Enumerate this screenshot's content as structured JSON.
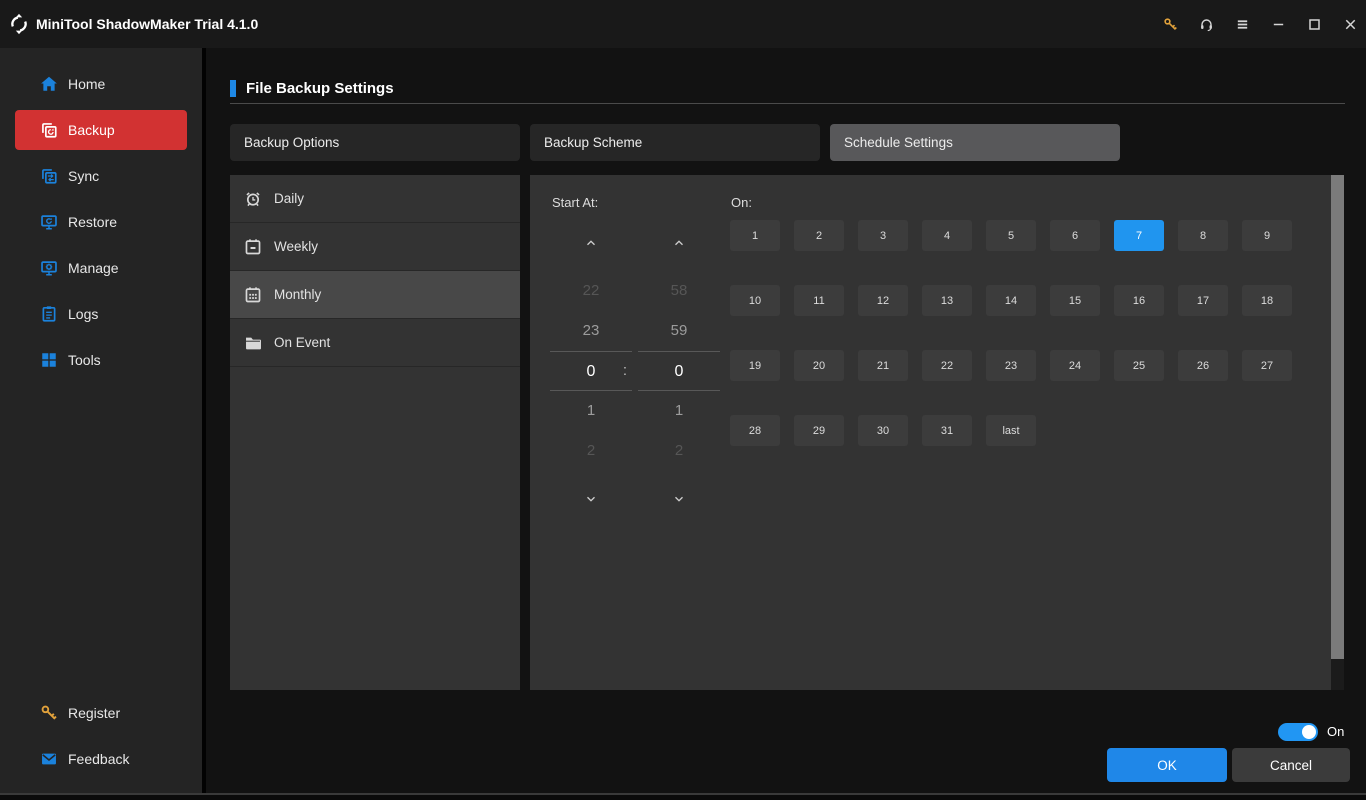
{
  "titlebar": {
    "title": "MiniTool ShadowMaker Trial 4.1.0",
    "buttons": [
      {
        "icon": "key",
        "name": "titlebar-key-button",
        "state": "gold"
      },
      {
        "icon": "headset",
        "name": "titlebar-support-button"
      },
      {
        "icon": "menu",
        "name": "titlebar-menu-button"
      },
      {
        "icon": "minimize",
        "name": "titlebar-minimize-button"
      },
      {
        "icon": "maximize",
        "name": "titlebar-maximize-button"
      },
      {
        "icon": "close",
        "name": "titlebar-close-button"
      }
    ]
  },
  "sidebar": {
    "items": [
      {
        "label": "Home",
        "icon": "home",
        "name": "sidebar-item-home"
      },
      {
        "label": "Backup",
        "icon": "backup",
        "name": "sidebar-item-backup",
        "state": "active"
      },
      {
        "label": "Sync",
        "icon": "sync",
        "name": "sidebar-item-sync"
      },
      {
        "label": "Restore",
        "icon": "restore",
        "name": "sidebar-item-restore"
      },
      {
        "label": "Manage",
        "icon": "manage",
        "name": "sidebar-item-manage"
      },
      {
        "label": "Logs",
        "icon": "logs",
        "name": "sidebar-item-logs"
      },
      {
        "label": "Tools",
        "icon": "tools",
        "name": "sidebar-item-tools"
      }
    ],
    "bottom_items": [
      {
        "label": "Register",
        "icon": "key",
        "name": "sidebar-item-register"
      },
      {
        "label": "Feedback",
        "icon": "mail",
        "name": "sidebar-item-feedback"
      }
    ]
  },
  "page": {
    "title": "File Backup Settings"
  },
  "tabs": [
    {
      "label": "Backup Options",
      "name": "tab-backup-options"
    },
    {
      "label": "Backup Scheme",
      "name": "tab-backup-scheme"
    },
    {
      "label": "Schedule Settings",
      "name": "tab-schedule-settings",
      "state": "active"
    }
  ],
  "schedule_types": [
    {
      "label": "Daily",
      "icon": "alarm",
      "name": "schedule-type-daily"
    },
    {
      "label": "Weekly",
      "icon": "cal-week",
      "name": "schedule-type-weekly"
    },
    {
      "label": "Monthly",
      "icon": "cal-month",
      "name": "schedule-type-monthly",
      "state": "selected"
    },
    {
      "label": "On Event",
      "icon": "folder",
      "name": "schedule-type-on-event"
    }
  ],
  "schedule": {
    "start_at_label": "Start At:",
    "time_separator": ":",
    "selected_hour": "0",
    "selected_minute": "0",
    "hour_values": [
      {
        "label": "22",
        "state": "dim"
      },
      {
        "label": "23",
        "state": "mid"
      },
      {
        "label": "0",
        "state": "sel"
      },
      {
        "label": "1",
        "state": "mid"
      },
      {
        "label": "2",
        "state": "dim"
      }
    ],
    "minute_values": [
      {
        "label": "58",
        "state": "dim"
      },
      {
        "label": "59",
        "state": "mid"
      },
      {
        "label": "0",
        "state": "sel"
      },
      {
        "label": "1",
        "state": "mid"
      },
      {
        "label": "2",
        "state": "dim"
      }
    ],
    "on_label": "On:",
    "selected_day": "7",
    "days": [
      {
        "label": "1"
      },
      {
        "label": "2"
      },
      {
        "label": "3"
      },
      {
        "label": "4"
      },
      {
        "label": "5"
      },
      {
        "label": "6"
      },
      {
        "label": "7",
        "state": "selected"
      },
      {
        "label": "8"
      },
      {
        "label": "9"
      },
      {
        "label": "10"
      },
      {
        "label": "11"
      },
      {
        "label": "12"
      },
      {
        "label": "13"
      },
      {
        "label": "14"
      },
      {
        "label": "15"
      },
      {
        "label": "16"
      },
      {
        "label": "17"
      },
      {
        "label": "18"
      },
      {
        "label": "19"
      },
      {
        "label": "20"
      },
      {
        "label": "21"
      },
      {
        "label": "22"
      },
      {
        "label": "23"
      },
      {
        "label": "24"
      },
      {
        "label": "25"
      },
      {
        "label": "26"
      },
      {
        "label": "27"
      },
      {
        "label": "28"
      },
      {
        "label": "29"
      },
      {
        "label": "30"
      },
      {
        "label": "31"
      },
      {
        "label": "last"
      }
    ]
  },
  "footer": {
    "schedule_toggle": "On",
    "ok_label": "OK",
    "cancel_label": "Cancel"
  },
  "colors": {
    "accent_blue": "#2095ef",
    "brand_red": "#d23232",
    "key_gold": "#e2a23b",
    "toggle_blue": "#2196f3"
  }
}
